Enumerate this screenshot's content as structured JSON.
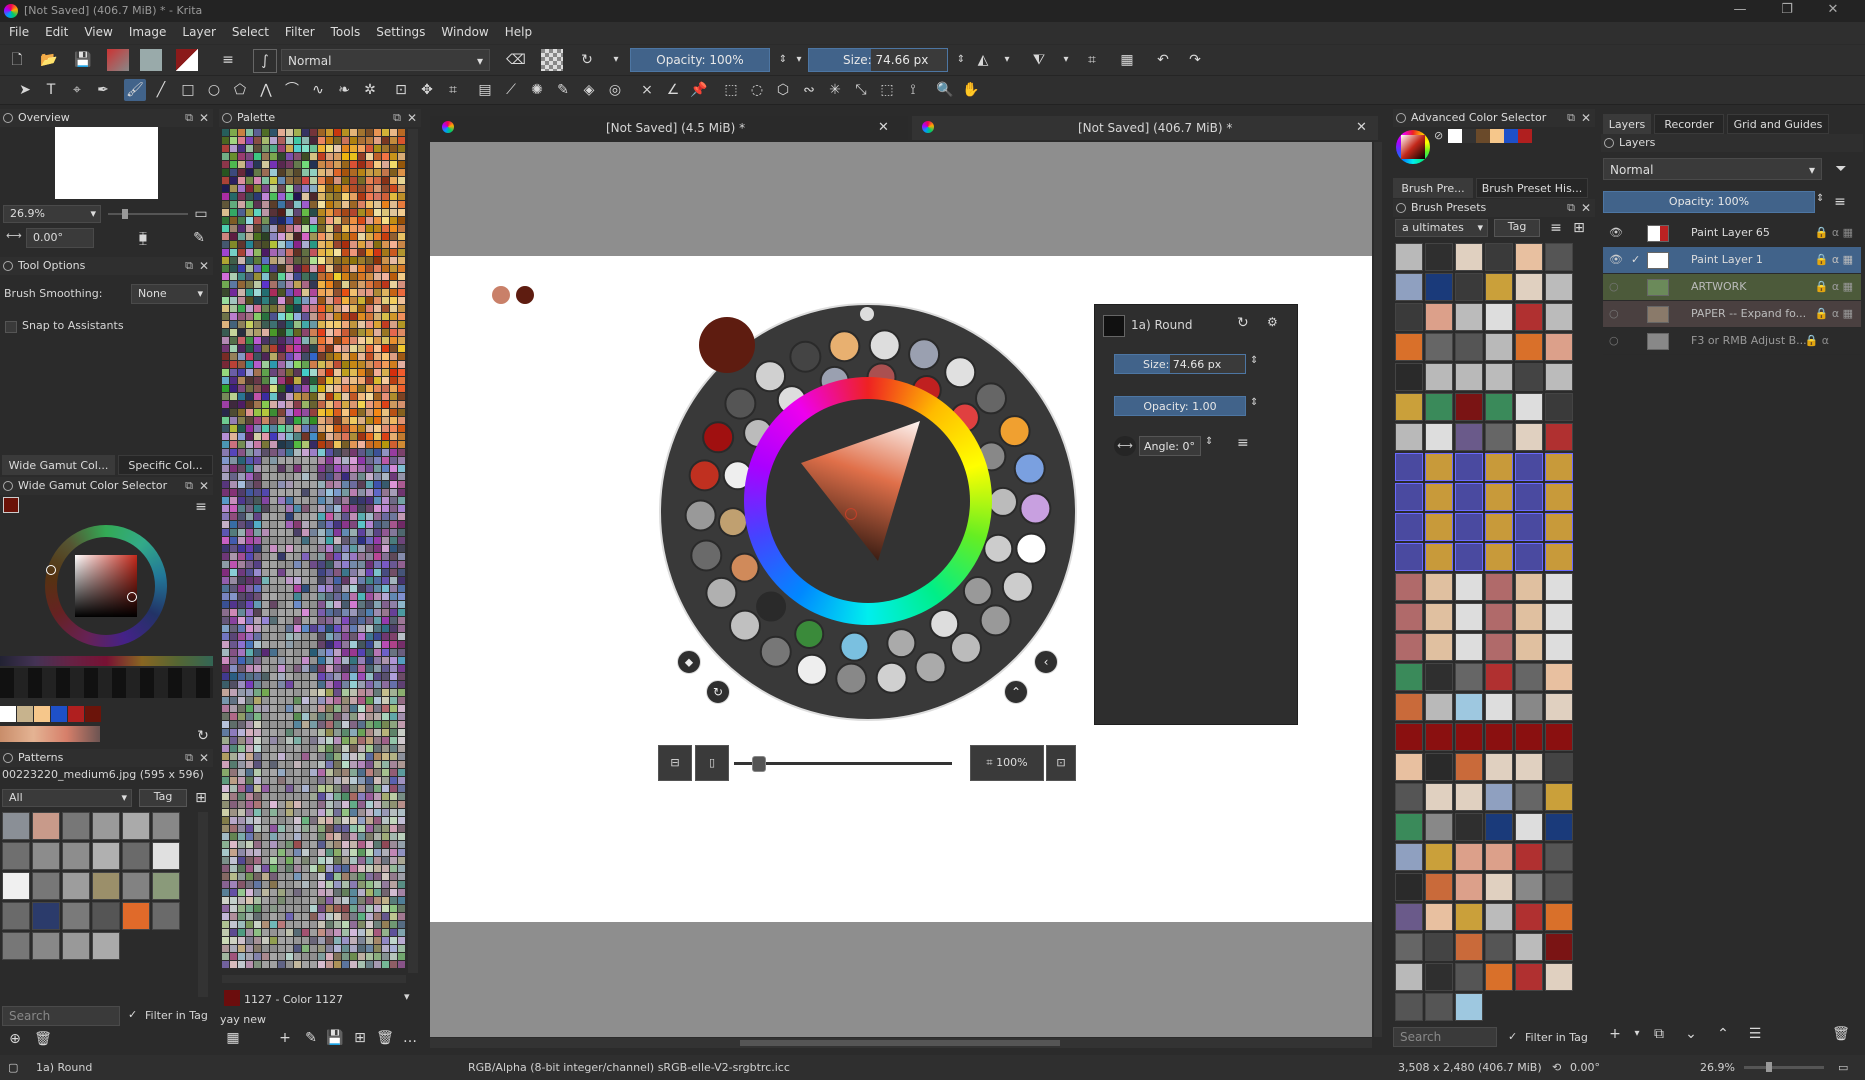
{
  "window": {
    "title": "[Not Saved]  (406.7 MiB) * - Krita",
    "minimize": "—",
    "maximize": "❐",
    "close": "✕"
  },
  "menu": [
    "File",
    "Edit",
    "View",
    "Image",
    "Layer",
    "Select",
    "Filter",
    "Tools",
    "Settings",
    "Window",
    "Help"
  ],
  "toolbar": {
    "blend_mode": "Normal",
    "opacity": "Opacity: 100%",
    "size_label": "Size:",
    "size_value": "74.66 px"
  },
  "overview": {
    "title": "Overview",
    "zoom": "26.9%",
    "rotation": "0.00°"
  },
  "tool_options": {
    "title": "Tool Options",
    "smoothing_label": "Brush Smoothing:",
    "smoothing_value": "None",
    "snap_label": "Snap to Assistants"
  },
  "color_tabs": [
    "Wide Gamut Col...",
    "Specific Col..."
  ],
  "wide_gamut": {
    "title": "Wide Gamut Color Selector"
  },
  "patterns": {
    "title": "Patterns",
    "file": "00223220_medium6.jpg (595 x 596)",
    "filter": "All",
    "tag": "Tag",
    "search_placeholder": "Search",
    "filter_in_tag": "Filter in Tag"
  },
  "palette": {
    "title": "Palette",
    "current": "1127 - Color 1127",
    "name": "yay new"
  },
  "docs": [
    {
      "title": "[Not Saved]  (4.5 MiB) *"
    },
    {
      "title": "[Not Saved]  (406.7 MiB) *"
    }
  ],
  "popup": {
    "preset": "1a) Round",
    "size_label": "Size:",
    "size_value": "74.66 px",
    "opacity": "Opacity: 1.00",
    "angle": "Angle: 0°"
  },
  "zoom_bar": {
    "zoom": "100%"
  },
  "advanced_color": {
    "title": "Advanced Color Selector"
  },
  "brush_tabs": [
    "Brush Pre...",
    "Brush Preset His..."
  ],
  "brush_presets": {
    "title": "Brush Presets",
    "tag_filter": "a ultimates",
    "tag": "Tag",
    "search_placeholder": "Search",
    "filter_in_tag": "Filter in Tag"
  },
  "right_tabs": [
    "Layers",
    "Recorder",
    "Grid and Guides"
  ],
  "layers": {
    "title": "Layers",
    "blend": "Normal",
    "opacity": "Opacity:  100%",
    "items": [
      {
        "name": "Paint Layer 65"
      },
      {
        "name": "Paint Layer 1"
      },
      {
        "name": "ARTWORK"
      },
      {
        "name": "PAPER -- Expand fo..."
      },
      {
        "name": "F3 or RMB Adjust B..."
      }
    ]
  },
  "status": {
    "brush": "1a) Round",
    "colorspace": "RGB/Alpha (8-bit integer/channel)  sRGB-elle-V2-srgbtrc.icc",
    "dimensions": "3,508 x 2,480 (406.7 MiB)",
    "rotation": "0.00°",
    "zoom": "26.9%"
  }
}
